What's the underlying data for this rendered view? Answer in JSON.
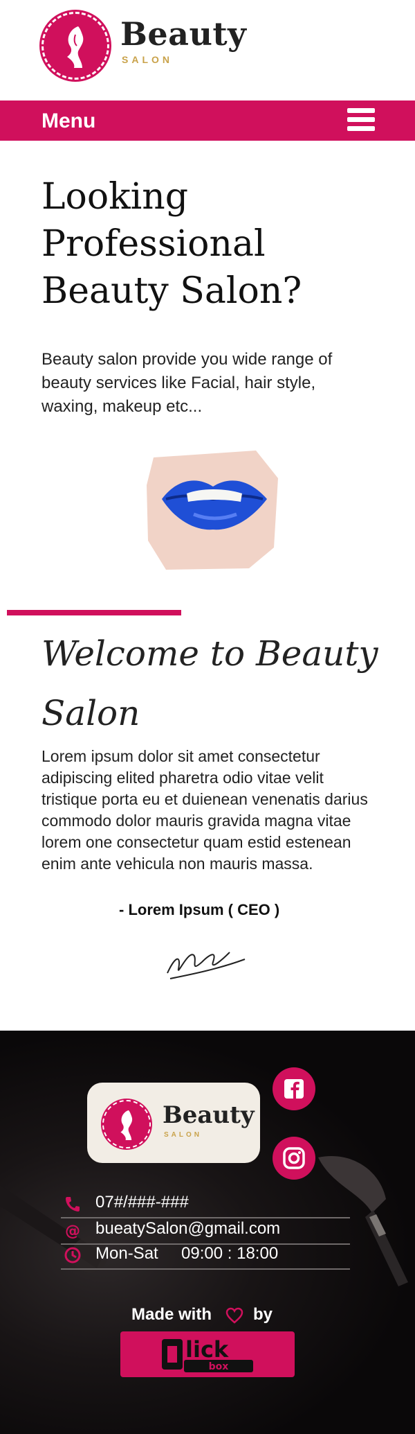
{
  "header": {
    "brand_name": "Beauty",
    "brand_tagline": "SALON",
    "menu_label": "Menu"
  },
  "hero": {
    "title": "Looking Professional Beauty Salon?",
    "description": "Beauty salon provide you wide range of beauty services like Facial, hair style, waxing, makeup etc..."
  },
  "welcome": {
    "title": "Welcome to Beauty Salon",
    "body": "Lorem ipsum dolor sit amet consectetur adipiscing elited pharetra odio vitae velit tristique porta eu et duienean venenatis darius commodo dolor mauris gravida magna vitae lorem one consectetur quam estid estenean enim ante vehicula non mauris massa.",
    "signoff": "- Lorem Ipsum ( CEO )"
  },
  "footer": {
    "brand_name": "Beauty",
    "brand_tagline": "SALON",
    "contacts": [
      {
        "icon": "phone-icon",
        "text": "07#/###-###"
      },
      {
        "icon": "at-icon",
        "text": "bueatySalon@gmail.com"
      },
      {
        "icon": "clock-icon",
        "text": "Mon-Sat     09:00 : 18:00"
      }
    ],
    "made_with": "Made with",
    "made_by": "by",
    "credit_logo": "Click box"
  },
  "colors": {
    "accent": "#d0105c",
    "gold": "#c9a24a",
    "lipstick": "#1f4fd6"
  }
}
